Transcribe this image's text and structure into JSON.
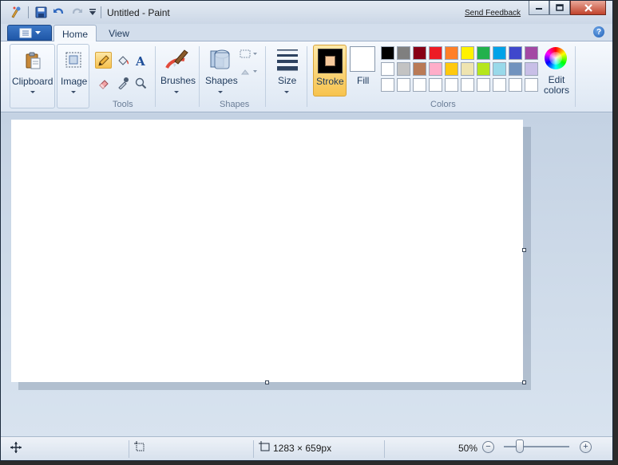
{
  "window": {
    "title": "Untitled - Paint",
    "send_feedback": "Send Feedback"
  },
  "tabs": [
    {
      "label": "Home",
      "active": true
    },
    {
      "label": "View",
      "active": false
    }
  ],
  "ribbon": {
    "clipboard": {
      "label": "Clipboard"
    },
    "image": {
      "label": "Image"
    },
    "tools": {
      "group_label": "Tools",
      "selected": "pencil"
    },
    "brushes": {
      "label": "Brushes"
    },
    "shapes": {
      "label": "Shapes",
      "group_label": "Shapes"
    },
    "size": {
      "label": "Size"
    },
    "stroke": {
      "label": "Stroke",
      "color": "#f5c99b"
    },
    "fill": {
      "label": "Fill",
      "color": "#ffffff"
    },
    "colors": {
      "group_label": "Colors",
      "edit_label": "Edit colors",
      "row1": [
        "#000000",
        "#7f7f7f",
        "#880015",
        "#ed1c24",
        "#ff7f27",
        "#fff200",
        "#22b14c",
        "#00a2e8",
        "#3f48cc",
        "#a349a4"
      ],
      "row2": [
        "#ffffff",
        "#c3c3c3",
        "#b97a57",
        "#ffaec9",
        "#ffc90e",
        "#efe4b0",
        "#b5e61d",
        "#99d9ea",
        "#7092be",
        "#c8bfe7"
      ],
      "row3": [
        "#ffffff",
        "#ffffff",
        "#ffffff",
        "#ffffff",
        "#ffffff",
        "#ffffff",
        "#ffffff",
        "#ffffff",
        "#ffffff",
        "#ffffff"
      ]
    }
  },
  "canvas": {
    "background": "#ffffff"
  },
  "status": {
    "dimensions": "1283 × 659px",
    "zoom": "50%"
  }
}
